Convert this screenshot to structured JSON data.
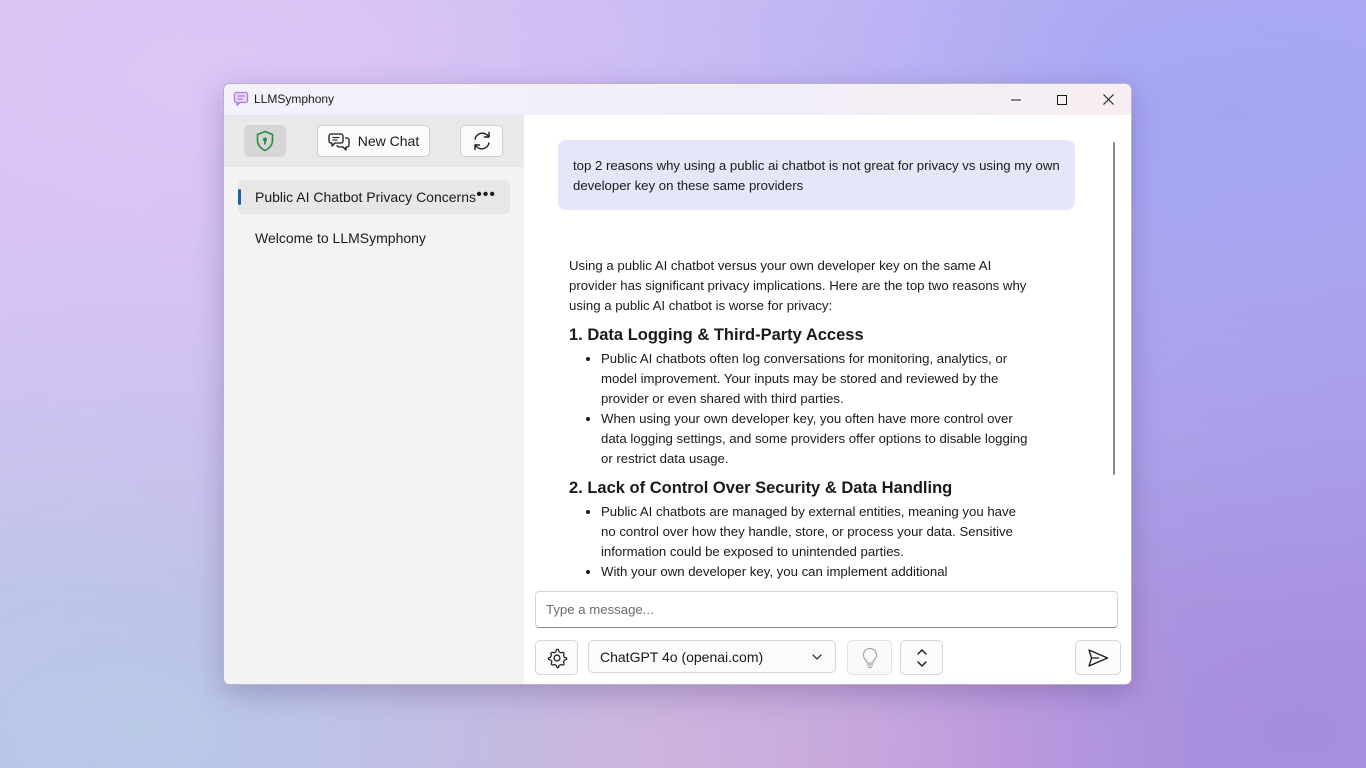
{
  "window": {
    "title": "LLMSymphony",
    "icon": "chat-bubble-icon"
  },
  "sidebar": {
    "toolbar": {
      "privacy_icon": "shield-icon",
      "new_chat_label": "New Chat",
      "new_chat_icon": "chat-bubbles-icon",
      "refresh_icon": "refresh-icon"
    },
    "chats": [
      {
        "label": "Public AI Chatbot Privacy Concerns",
        "selected": true,
        "more": "•••"
      },
      {
        "label": "Welcome to LLMSymphony",
        "selected": false
      }
    ]
  },
  "conversation": {
    "user_message": "top 2 reasons why using a public ai chatbot is not great for privacy vs using my own developer key on these same providers",
    "assistant": {
      "intro": "Using a public AI chatbot versus your own developer key on the same AI provider has significant privacy implications. Here are the top two reasons why using a public AI chatbot is worse for privacy:",
      "sections": [
        {
          "heading": "1. Data Logging & Third-Party Access",
          "bullets": [
            "Public AI chatbots often log conversations for monitoring, analytics, or model improvement. Your inputs may be stored and reviewed by the provider or even shared with third parties.",
            "When using your own developer key, you often have more control over data logging settings, and some providers offer options to disable logging or restrict data usage."
          ]
        },
        {
          "heading": "2. Lack of Control Over Security & Data Handling",
          "bullets": [
            "Public AI chatbots are managed by external entities, meaning you have no control over how they handle, store, or process your data. Sensitive information could be exposed to unintended parties.",
            "With your own developer key, you can implement additional"
          ]
        }
      ]
    }
  },
  "composer": {
    "placeholder": "Type a message...",
    "model": "ChatGPT 4o (openai.com)",
    "icons": {
      "settings": "gear-icon",
      "bulb": "lightbulb-icon",
      "expand": "expand-vertical-icon",
      "send": "send-icon"
    }
  },
  "colors": {
    "accent": "#1f5fa8",
    "user_bubble": "#e6e6f9",
    "shield": "#2e8b3e",
    "app_icon": "#b07fd8"
  }
}
